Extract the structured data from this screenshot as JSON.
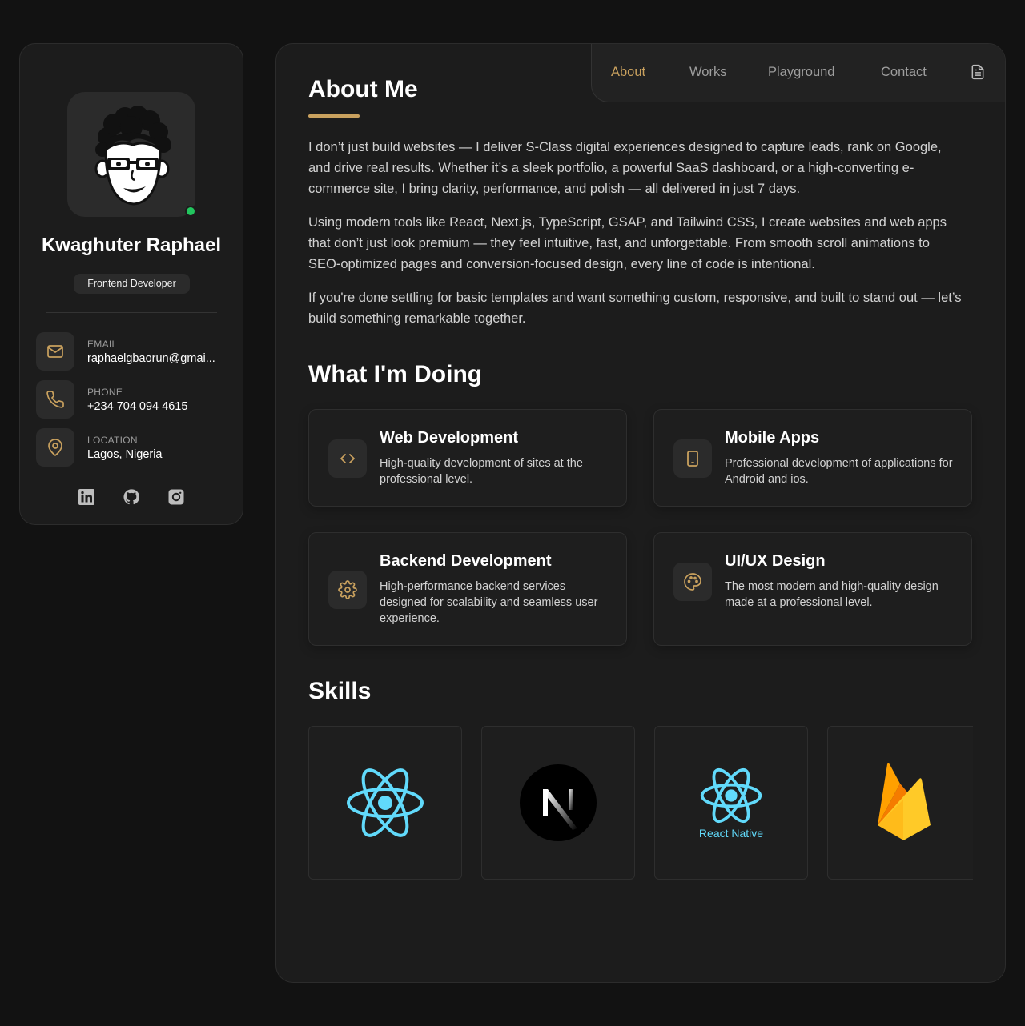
{
  "profile": {
    "name": "Kwaghuter Raphael",
    "role": "Frontend Developer",
    "status_color": "#22c55e"
  },
  "contacts": [
    {
      "label": "EMAIL",
      "value": "raphaelgbaorun@gmai...",
      "icon": "mail-icon"
    },
    {
      "label": "PHONE",
      "value": "+234 704 094 4615",
      "icon": "phone-icon"
    },
    {
      "label": "LOCATION",
      "value": "Lagos, Nigeria",
      "icon": "location-pin-icon"
    }
  ],
  "socials": [
    "linkedin-icon",
    "github-icon",
    "instagram-icon"
  ],
  "nav": {
    "items": [
      "About",
      "Works",
      "Playground",
      "Contact"
    ],
    "active": "About",
    "resume_icon": "document-icon"
  },
  "about": {
    "title": "About Me",
    "paragraphs": [
      "I don’t just build websites — I deliver S-Class digital experiences designed to capture leads, rank on Google, and drive real results. Whether it’s a sleek portfolio, a powerful SaaS dashboard, or a high-converting e-commerce site, I bring clarity, performance, and polish — all delivered in just 7 days.",
      "Using modern tools like React, Next.js, TypeScript, GSAP, and Tailwind CSS, I create websites and web apps that don’t just look premium — they feel intuitive, fast, and unforgettable. From smooth scroll animations to SEO-optimized pages and conversion-focused design, every line of code is intentional.",
      "If you're done settling for basic templates and want something custom, responsive, and built to stand out — let’s build something remarkable together."
    ]
  },
  "services": {
    "title": "What I'm Doing",
    "items": [
      {
        "title": "Web Development",
        "desc": "High-quality development of sites at the professional level.",
        "icon": "code-icon"
      },
      {
        "title": "Mobile Apps",
        "desc": "Professional development of applications for Android and ios.",
        "icon": "mobile-icon"
      },
      {
        "title": "Backend Development",
        "desc": "High-performance backend services designed for scalability and seamless user experience.",
        "icon": "gear-icon"
      },
      {
        "title": "UI/UX Design",
        "desc": "The most modern and high-quality design made at a professional level.",
        "icon": "palette-icon"
      }
    ]
  },
  "skills": {
    "title": "Skills",
    "items": [
      {
        "icon": "react-icon"
      },
      {
        "icon": "nextjs-icon"
      },
      {
        "icon": "react-native-icon",
        "caption": "React Native"
      },
      {
        "icon": "firebase-icon"
      }
    ]
  },
  "colors": {
    "accent": "#c9a15e",
    "background": "#121212",
    "card": "#1c1c1c",
    "react_blue": "#61dafb"
  }
}
